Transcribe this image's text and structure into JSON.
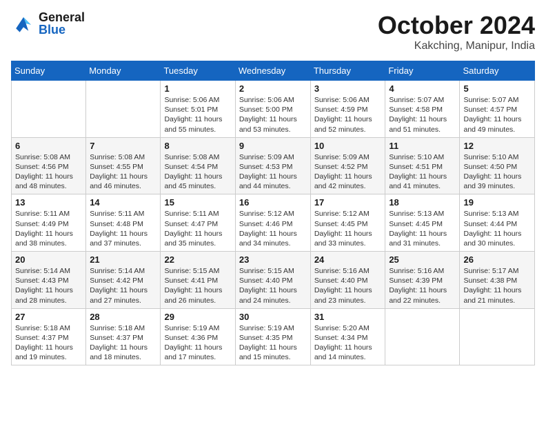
{
  "header": {
    "logo_general": "General",
    "logo_blue": "Blue",
    "month": "October 2024",
    "location": "Kakching, Manipur, India"
  },
  "weekdays": [
    "Sunday",
    "Monday",
    "Tuesday",
    "Wednesday",
    "Thursday",
    "Friday",
    "Saturday"
  ],
  "weeks": [
    [
      {
        "day": "",
        "info": ""
      },
      {
        "day": "",
        "info": ""
      },
      {
        "day": "1",
        "info": "Sunrise: 5:06 AM\nSunset: 5:01 PM\nDaylight: 11 hours and 55 minutes."
      },
      {
        "day": "2",
        "info": "Sunrise: 5:06 AM\nSunset: 5:00 PM\nDaylight: 11 hours and 53 minutes."
      },
      {
        "day": "3",
        "info": "Sunrise: 5:06 AM\nSunset: 4:59 PM\nDaylight: 11 hours and 52 minutes."
      },
      {
        "day": "4",
        "info": "Sunrise: 5:07 AM\nSunset: 4:58 PM\nDaylight: 11 hours and 51 minutes."
      },
      {
        "day": "5",
        "info": "Sunrise: 5:07 AM\nSunset: 4:57 PM\nDaylight: 11 hours and 49 minutes."
      }
    ],
    [
      {
        "day": "6",
        "info": "Sunrise: 5:08 AM\nSunset: 4:56 PM\nDaylight: 11 hours and 48 minutes."
      },
      {
        "day": "7",
        "info": "Sunrise: 5:08 AM\nSunset: 4:55 PM\nDaylight: 11 hours and 46 minutes."
      },
      {
        "day": "8",
        "info": "Sunrise: 5:08 AM\nSunset: 4:54 PM\nDaylight: 11 hours and 45 minutes."
      },
      {
        "day": "9",
        "info": "Sunrise: 5:09 AM\nSunset: 4:53 PM\nDaylight: 11 hours and 44 minutes."
      },
      {
        "day": "10",
        "info": "Sunrise: 5:09 AM\nSunset: 4:52 PM\nDaylight: 11 hours and 42 minutes."
      },
      {
        "day": "11",
        "info": "Sunrise: 5:10 AM\nSunset: 4:51 PM\nDaylight: 11 hours and 41 minutes."
      },
      {
        "day": "12",
        "info": "Sunrise: 5:10 AM\nSunset: 4:50 PM\nDaylight: 11 hours and 39 minutes."
      }
    ],
    [
      {
        "day": "13",
        "info": "Sunrise: 5:11 AM\nSunset: 4:49 PM\nDaylight: 11 hours and 38 minutes."
      },
      {
        "day": "14",
        "info": "Sunrise: 5:11 AM\nSunset: 4:48 PM\nDaylight: 11 hours and 37 minutes."
      },
      {
        "day": "15",
        "info": "Sunrise: 5:11 AM\nSunset: 4:47 PM\nDaylight: 11 hours and 35 minutes."
      },
      {
        "day": "16",
        "info": "Sunrise: 5:12 AM\nSunset: 4:46 PM\nDaylight: 11 hours and 34 minutes."
      },
      {
        "day": "17",
        "info": "Sunrise: 5:12 AM\nSunset: 4:45 PM\nDaylight: 11 hours and 33 minutes."
      },
      {
        "day": "18",
        "info": "Sunrise: 5:13 AM\nSunset: 4:45 PM\nDaylight: 11 hours and 31 minutes."
      },
      {
        "day": "19",
        "info": "Sunrise: 5:13 AM\nSunset: 4:44 PM\nDaylight: 11 hours and 30 minutes."
      }
    ],
    [
      {
        "day": "20",
        "info": "Sunrise: 5:14 AM\nSunset: 4:43 PM\nDaylight: 11 hours and 28 minutes."
      },
      {
        "day": "21",
        "info": "Sunrise: 5:14 AM\nSunset: 4:42 PM\nDaylight: 11 hours and 27 minutes."
      },
      {
        "day": "22",
        "info": "Sunrise: 5:15 AM\nSunset: 4:41 PM\nDaylight: 11 hours and 26 minutes."
      },
      {
        "day": "23",
        "info": "Sunrise: 5:15 AM\nSunset: 4:40 PM\nDaylight: 11 hours and 24 minutes."
      },
      {
        "day": "24",
        "info": "Sunrise: 5:16 AM\nSunset: 4:40 PM\nDaylight: 11 hours and 23 minutes."
      },
      {
        "day": "25",
        "info": "Sunrise: 5:16 AM\nSunset: 4:39 PM\nDaylight: 11 hours and 22 minutes."
      },
      {
        "day": "26",
        "info": "Sunrise: 5:17 AM\nSunset: 4:38 PM\nDaylight: 11 hours and 21 minutes."
      }
    ],
    [
      {
        "day": "27",
        "info": "Sunrise: 5:18 AM\nSunset: 4:37 PM\nDaylight: 11 hours and 19 minutes."
      },
      {
        "day": "28",
        "info": "Sunrise: 5:18 AM\nSunset: 4:37 PM\nDaylight: 11 hours and 18 minutes."
      },
      {
        "day": "29",
        "info": "Sunrise: 5:19 AM\nSunset: 4:36 PM\nDaylight: 11 hours and 17 minutes."
      },
      {
        "day": "30",
        "info": "Sunrise: 5:19 AM\nSunset: 4:35 PM\nDaylight: 11 hours and 15 minutes."
      },
      {
        "day": "31",
        "info": "Sunrise: 5:20 AM\nSunset: 4:34 PM\nDaylight: 11 hours and 14 minutes."
      },
      {
        "day": "",
        "info": ""
      },
      {
        "day": "",
        "info": ""
      }
    ]
  ]
}
